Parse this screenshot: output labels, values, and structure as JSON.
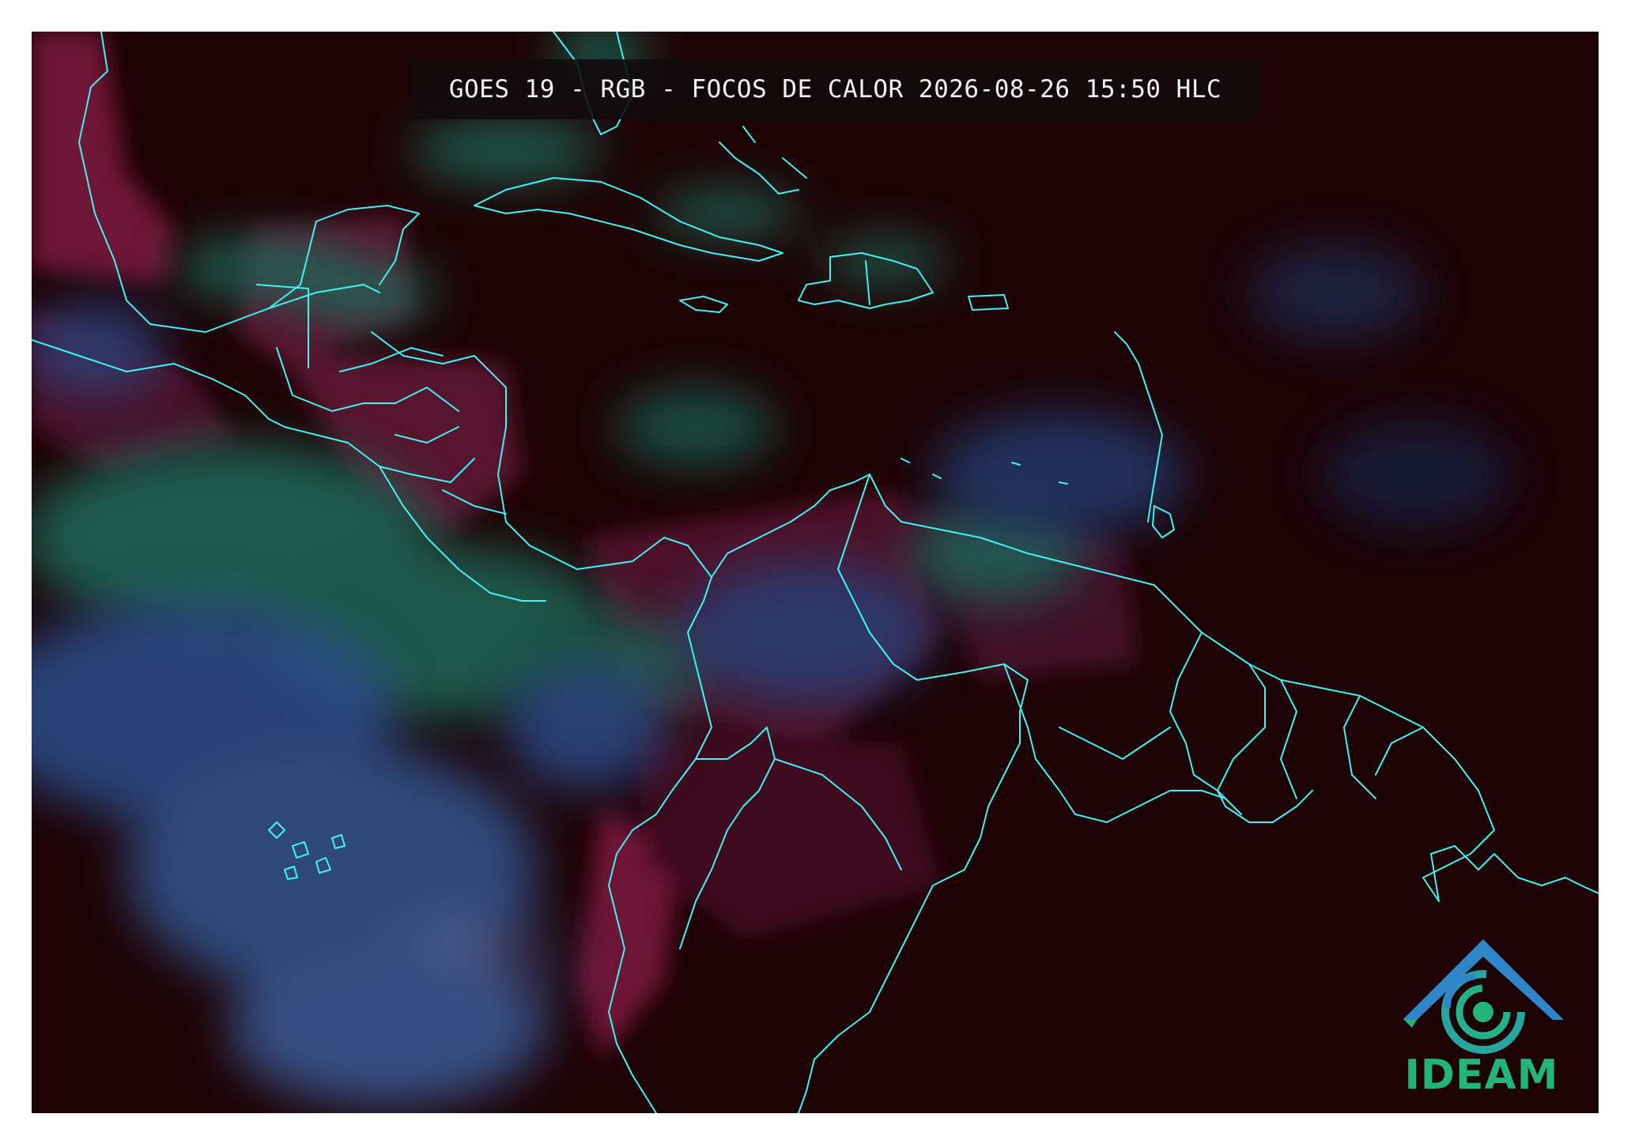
{
  "map": {
    "title": "GOES 19 - RGB - FOCOS DE CALOR 2026-08-26 15:50 HLC"
  },
  "logo": {
    "text": "IDEAM"
  },
  "colors": {
    "background": "#1e0306",
    "coastline": "#3ff3f0",
    "cloud_teal": "#1f6b5a",
    "cloud_blue": "#2c4e8c",
    "land_magenta": "#7a1a3e",
    "logo_green": "#21b57a",
    "logo_blue": "#2e86c9"
  }
}
